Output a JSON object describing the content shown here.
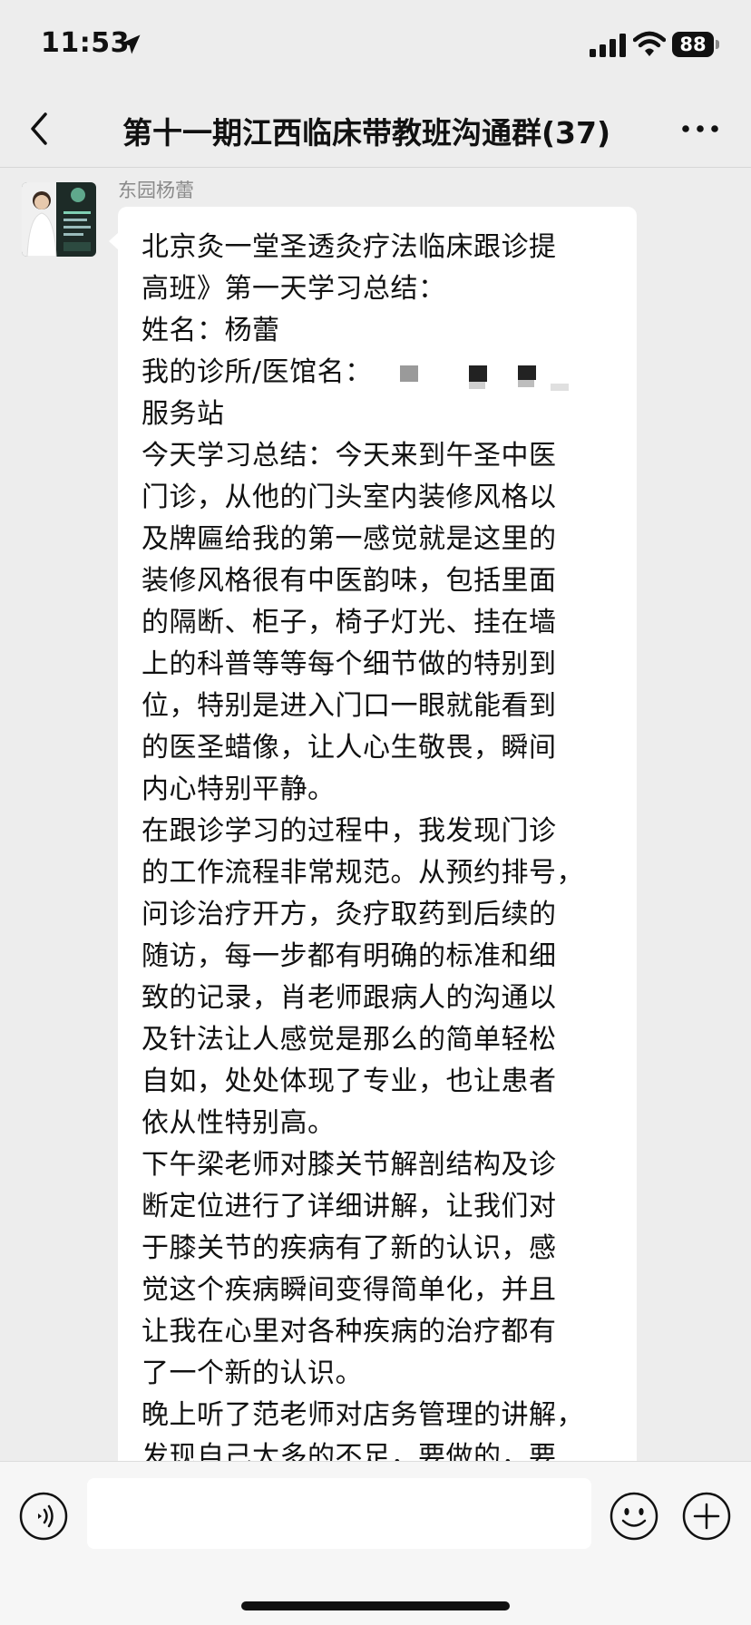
{
  "status_bar": {
    "time": "11:53",
    "battery": "88",
    "icons": [
      "location-arrow-icon",
      "signal-icon",
      "wifi-icon"
    ]
  },
  "nav": {
    "title": "第十一期江西临床带教班沟通群(37)",
    "back_icon": "chevron-left-icon",
    "more_icon": "more-dots-icon"
  },
  "message": {
    "sender": "东园杨蕾",
    "lines": [
      "北京灸一堂圣透灸疗法临床跟诊提",
      "高班》第一天学习总结：",
      "姓名：杨蕾",
      "我的诊所/医馆名：",
      "服务站",
      "今天学习总结：今天来到午圣中医",
      "门诊，从他的门头室内装修风格以",
      "及牌匾给我的第一感觉就是这里的",
      "装修风格很有中医韵味，包括里面",
      "的隔断、柜子，椅子灯光、挂在墙",
      "上的科普等等每个细节做的特别到",
      "位，特别是进入门口一眼就能看到",
      "的医圣蜡像，让人心生敬畏，瞬间",
      "内心特别平静。",
      "在跟诊学习的过程中，我发现门诊",
      "的工作流程非常规范。从预约排号，",
      "问诊治疗开方，灸疗取药到后续的",
      "随访，每一步都有明确的标准和细",
      "致的记录，肖老师跟病人的沟通以",
      "及针法让人感觉是那么的简单轻松",
      "自如，处处体现了专业，也让患者",
      "依从性特别高。",
      " 下午梁老师对膝关节解剖结构及诊",
      "断定位进行了详细讲解，让我们对",
      "于膝关节的疾病有了新的认识，感",
      "觉这个疾病瞬间变得简单化，并且",
      "让我在心里对各种疾病的治疗都有",
      "了一个新的认识。",
      "晚上听了范老师对店务管理的讲解，",
      "发现自己太多的不足，要做的，要"
    ]
  },
  "input_bar": {
    "placeholder": "",
    "voice_icon": "voice-icon",
    "emoji_icon": "emoji-icon",
    "plus_icon": "plus-icon"
  },
  "colors": {
    "background": "#ededed",
    "bubble": "#ffffff",
    "text": "#111111",
    "sender_name": "#8a8a8a"
  }
}
